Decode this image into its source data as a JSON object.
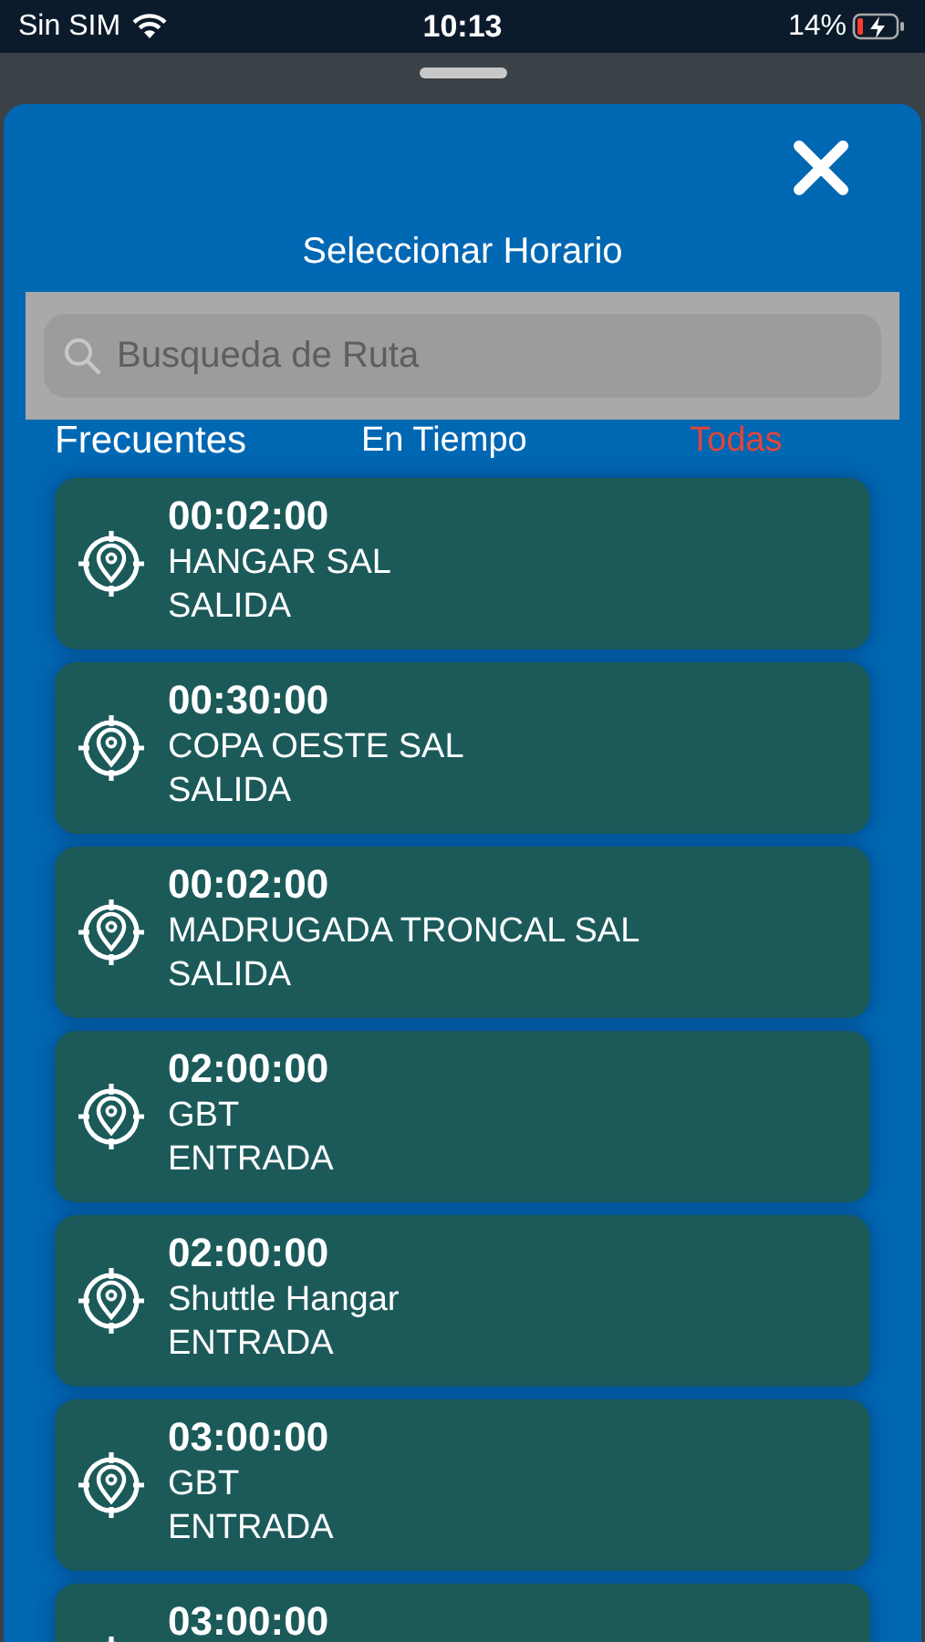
{
  "status_bar": {
    "carrier": "Sin SIM",
    "time": "10:13",
    "battery": "14%"
  },
  "sheet": {
    "title": "Seleccionar Horario",
    "search": {
      "placeholder": "Busqueda de Ruta"
    },
    "tabs": [
      {
        "label": "Frecuentes",
        "selected": false
      },
      {
        "label": "En Tiempo",
        "selected": false
      },
      {
        "label": "Todas",
        "selected": true
      }
    ],
    "schedules": [
      {
        "time": "00:02:00",
        "route": "HANGAR SAL",
        "direction": "SALIDA"
      },
      {
        "time": "00:30:00",
        "route": "COPA OESTE SAL",
        "direction": "SALIDA"
      },
      {
        "time": "00:02:00",
        "route": "MADRUGADA TRONCAL SAL",
        "direction": "SALIDA"
      },
      {
        "time": "02:00:00",
        "route": "GBT",
        "direction": "ENTRADA"
      },
      {
        "time": "02:00:00",
        "route": "Shuttle Hangar",
        "direction": "ENTRADA"
      },
      {
        "time": "03:00:00",
        "route": "GBT",
        "direction": "ENTRADA"
      },
      {
        "time": "03:00:00"
      }
    ]
  }
}
